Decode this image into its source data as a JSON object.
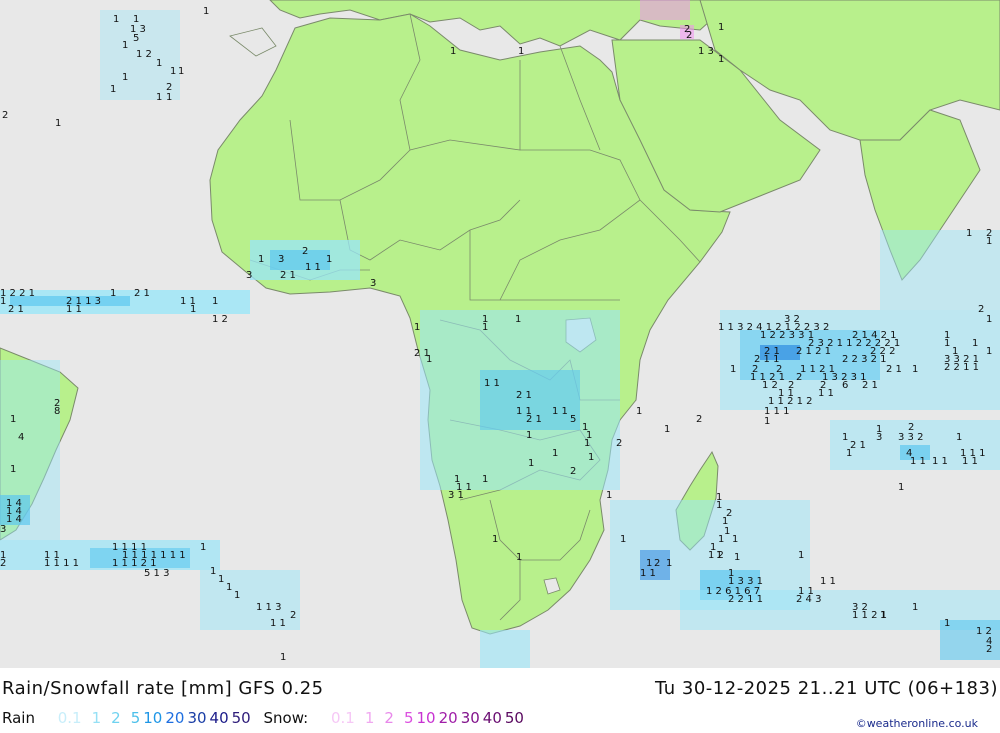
{
  "title": {
    "left": "Rain/Snowfall rate [mm] GFS 0.25",
    "right": "Tu 30-12-2025 21..21 UTC (06+183)"
  },
  "legend": {
    "rain_label": "Rain",
    "rain_items": [
      {
        "text": "0.1",
        "color": "#c8eefa"
      },
      {
        "text": "1",
        "color": "#96e0f5"
      },
      {
        "text": "2",
        "color": "#6fd2f0"
      },
      {
        "text": "5",
        "color": "#4cc0ea"
      },
      {
        "text": "10",
        "color": "#1e96e6"
      },
      {
        "text": "20",
        "color": "#1e6ee0"
      },
      {
        "text": "30",
        "color": "#1a3ea6"
      },
      {
        "text": "40",
        "color": "#1c1c8a"
      },
      {
        "text": "50",
        "color": "#2e1c7a"
      }
    ],
    "snow_label": "Snow:",
    "snow_items": [
      {
        "text": "0.1",
        "color": "#f6c8f6"
      },
      {
        "text": "1",
        "color": "#f0a8f0"
      },
      {
        "text": "2",
        "color": "#e888ea"
      },
      {
        "text": "5",
        "color": "#dc50e0"
      },
      {
        "text": "10",
        "color": "#c832d2"
      },
      {
        "text": "20",
        "color": "#a01ea8"
      },
      {
        "text": "30",
        "color": "#82148c"
      },
      {
        "text": "40",
        "color": "#6a0e72"
      },
      {
        "text": "50",
        "color": "#5a0a60"
      }
    ]
  },
  "credit": "©weatheronline.co.uk",
  "colors": {
    "ocean": "#e8e8e8",
    "land": "#b8f08c",
    "border": "#7a8a6a",
    "rain_light": "#9ae6f8",
    "rain_mid": "#5cc8f0",
    "rain_heavy": "#1e7ee0",
    "snow": "#f090f0"
  },
  "map_labels": [
    "1",
    "2",
    "3",
    "4",
    "5",
    "6",
    "7",
    "8"
  ]
}
